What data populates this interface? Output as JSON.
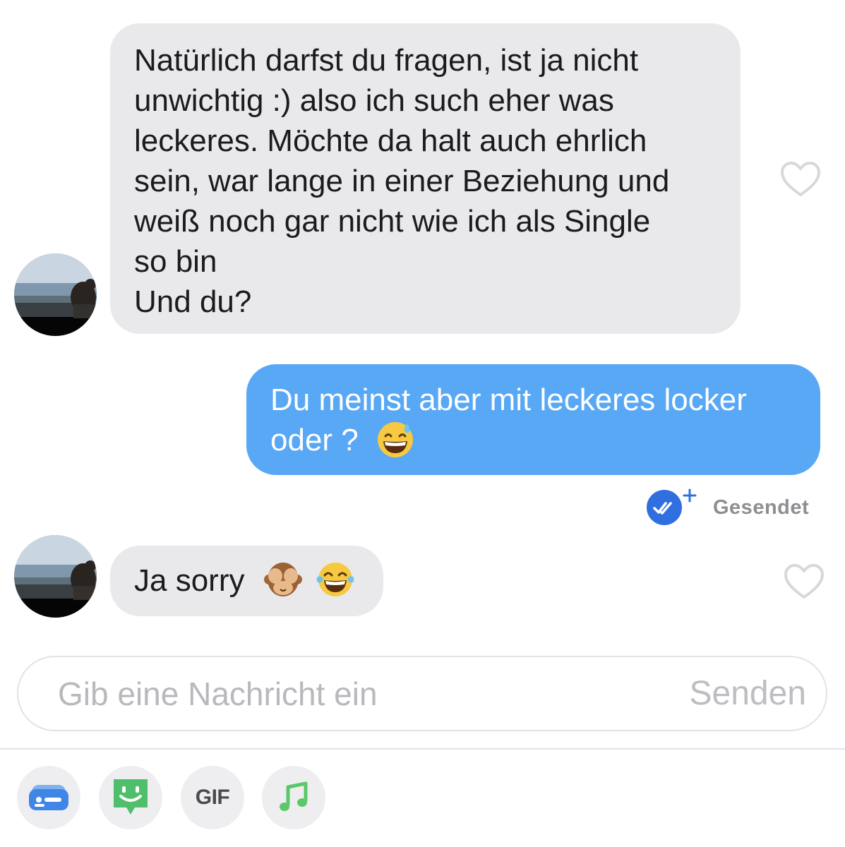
{
  "conversation": {
    "messages": [
      {
        "direction": "incoming",
        "lines": [
          "Natürlich darfst du fragen, ist ja nicht",
          "unwichtig :) also ich such eher was",
          "leckeres. Möchte da halt auch ehrlich",
          "sein, war lange in einer Beziehung und",
          "weiß noch gar nicht wie ich als Single",
          "so bin",
          "Und du?"
        ]
      },
      {
        "direction": "outgoing",
        "lines": [
          "Du meinst aber mit leckeres locker",
          "oder ?"
        ],
        "emoji": "grinning-sweat-emoji",
        "status": "Gesendet"
      },
      {
        "direction": "incoming",
        "text": "Ja sorry",
        "emojis": [
          "see-no-evil-monkey-emoji",
          "tears-of-joy-emoji"
        ]
      }
    ]
  },
  "composer": {
    "placeholder": "Gib eine Nachricht ein",
    "value": "",
    "send_label": "Senden"
  },
  "toolbar": {
    "items": [
      {
        "icon": "contact-card-icon"
      },
      {
        "icon": "sticker-icon"
      },
      {
        "icon": "gif-icon",
        "label": "GIF"
      },
      {
        "icon": "music-note-icon"
      }
    ]
  },
  "colors": {
    "incoming_bubble": "#e9e9eb",
    "outgoing_bubble": "#58a8f5",
    "read_receipt": "#2f6fe0",
    "sticker_green": "#4fbf6b",
    "music_green": "#5ac86a"
  }
}
